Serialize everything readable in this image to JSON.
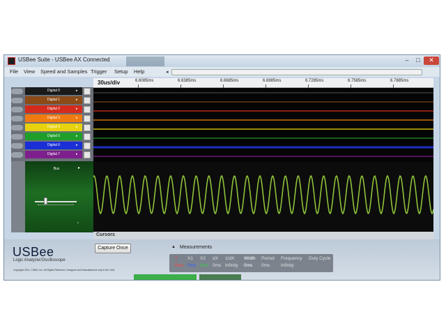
{
  "window": {
    "title": "USBee Suite - USBee AX Connected",
    "min": "–",
    "max": "□",
    "close": "✕"
  },
  "menu": [
    "File",
    "View",
    "Speed and Samples",
    "Trigger",
    "Setup",
    "Help"
  ],
  "scroll_left": "◂",
  "timebar": {
    "div": "30us/div",
    "ticks": [
      "6.6085ms",
      "6.6385ms",
      "6.6685ms",
      "6.6985ms",
      "6.7285ms",
      "6.7585ms",
      "6.7885ms"
    ]
  },
  "channels": [
    {
      "label": "Digital 0",
      "color": "#1a1a1a"
    },
    {
      "label": "Digital 1",
      "color": "#8b4a16"
    },
    {
      "label": "Digital 2",
      "color": "#d42a1c"
    },
    {
      "label": "Digital 3",
      "color": "#f07a10"
    },
    {
      "label": "Digital 4",
      "color": "#e8d20e"
    },
    {
      "label": "Digital 5",
      "color": "#1f9e2a"
    },
    {
      "label": "Digital 6",
      "color": "#1a2fd6"
    },
    {
      "label": "Digital 7",
      "color": "#7e1f8e"
    }
  ],
  "channel_arrow": "▸",
  "analog": {
    "label": "Bus",
    "arrow": "▸",
    "dot": "•"
  },
  "trace_colors": {
    "digital": [
      "#3a3a3a",
      "#6b3a12",
      "#b5281a",
      "#c9700f",
      "#c9b80c",
      "#1a7d22",
      "#1e2fc8",
      "#6a1c78"
    ],
    "analog": "#8fc23a"
  },
  "cursors_label": "Cursors",
  "brand": {
    "name": "USBee",
    "tagline": "Logic Analyzer/Oscilloscope",
    "copyright": "Copyright 2011, CWAV, Inc. All Rights Reserved. Designed and Manufactured only in the USA"
  },
  "capture_button": "Capture Once",
  "measurements": {
    "toggle": "▲",
    "title": "Measurements",
    "headers": [
      {
        "text": "T",
        "color": "#e05050"
      },
      {
        "text": "X1",
        "color": "#e0e0e0"
      },
      {
        "text": "X2",
        "color": "#e0e0e0"
      },
      {
        "text": "dX",
        "color": "#e0e0e0"
      },
      {
        "text": "1/dX",
        "color": "#e0e0e0"
      },
      {
        "text": "Width",
        "color": "#ffffff"
      },
      {
        "text": "Period",
        "color": "#e0e0e0"
      },
      {
        "text": "Frequency",
        "color": "#e0e0e0"
      },
      {
        "text": "Duty Cycle",
        "color": "#e0e0e0"
      }
    ],
    "values": [
      {
        "text": "0ms",
        "color": "#ff4040"
      },
      {
        "text": "0ms",
        "color": "#3060ff"
      },
      {
        "text": "0ms",
        "color": "#30d040"
      },
      {
        "text": "0ms",
        "color": "#e0e0e0"
      },
      {
        "text": "Infinity",
        "color": "#e0e0e0"
      },
      {
        "text": "0ms",
        "color": "#ffffff"
      },
      {
        "text": "0ms",
        "color": "#e0e0e0"
      },
      {
        "text": "Infinity",
        "color": "#e0e0e0"
      }
    ]
  }
}
